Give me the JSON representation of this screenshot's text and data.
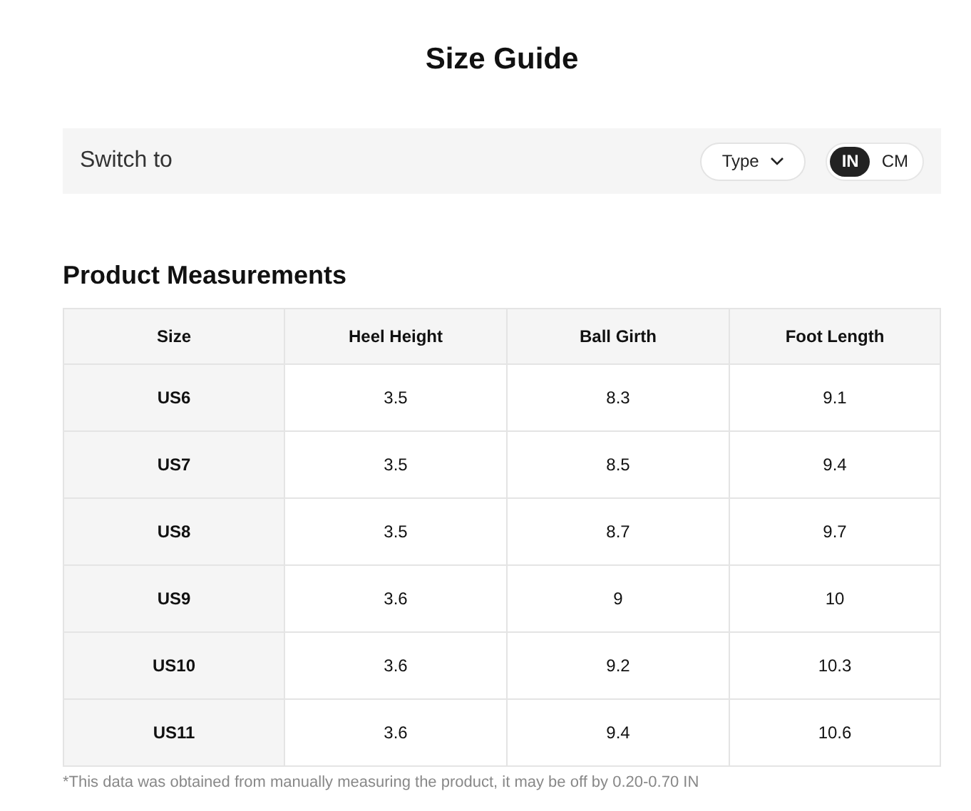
{
  "title": "Size Guide",
  "switch_bar": {
    "label": "Switch to",
    "type_dropdown": "Type",
    "units": [
      {
        "label": "IN",
        "selected": true
      },
      {
        "label": "CM",
        "selected": false
      }
    ]
  },
  "section_title": "Product Measurements",
  "table": {
    "columns": [
      "Size",
      "Heel Height",
      "Ball Girth",
      "Foot Length"
    ],
    "rows": [
      [
        "US6",
        "3.5",
        "8.3",
        "9.1"
      ],
      [
        "US7",
        "3.5",
        "8.5",
        "9.4"
      ],
      [
        "US8",
        "3.5",
        "8.7",
        "9.7"
      ],
      [
        "US9",
        "3.6",
        "9",
        "10"
      ],
      [
        "US10",
        "3.6",
        "9.2",
        "10.3"
      ],
      [
        "US11",
        "3.6",
        "9.4",
        "10.6"
      ]
    ]
  },
  "footnote": "*This data was obtained from manually measuring the product, it may be off by 0.20-0.70 IN"
}
